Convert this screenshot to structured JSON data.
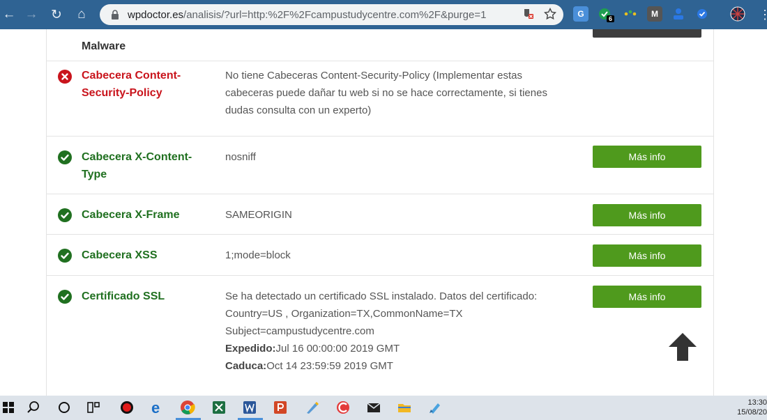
{
  "browser": {
    "url_host": "wpdoctor.es",
    "url_path": "/analisis/?url=http:%2F%2Fcampustudycentre.com%2F&purge=1",
    "extension_badge": "6",
    "ext_m_label": "M"
  },
  "rows": [
    {
      "name": "Malware"
    },
    {
      "name": "Cabecera Content-Security-Policy",
      "status": "error",
      "desc": "No tiene Cabeceras Content-Security-Policy (Implementar estas cabeceras puede dañar tu web si no se hace correctamente, si tienes dudas consulta con un experto)"
    },
    {
      "name": "Cabecera X-Content-Type",
      "status": "ok",
      "desc": "nosniff",
      "button": "Más info"
    },
    {
      "name": "Cabecera X-Frame",
      "status": "ok",
      "desc": "SAMEORIGIN",
      "button": "Más info"
    },
    {
      "name": "Cabecera XSS",
      "status": "ok",
      "desc": "1;mode=block",
      "button": "Más info"
    },
    {
      "name": "Certificado SSL",
      "status": "ok",
      "desc_main": "Se ha detectado un certificado SSL instalado. Datos del certificado: Country=US , Organization=TX,CommonName=TX Subject=campustudycentre.com",
      "issued_label": "Expedido:",
      "issued_value": "Jul 16 00:00:00 2019 GMT",
      "expires_label": "Caduca:",
      "expires_value": "Oct 14 23:59:59 2019 GMT",
      "button": "Más info"
    }
  ],
  "colors": {
    "ok": "#207020",
    "error": "#c9141c",
    "button": "#4f9a1d",
    "chrome": "#2f6393"
  },
  "taskbar": {
    "time": "13:30",
    "date": "15/08/20"
  }
}
